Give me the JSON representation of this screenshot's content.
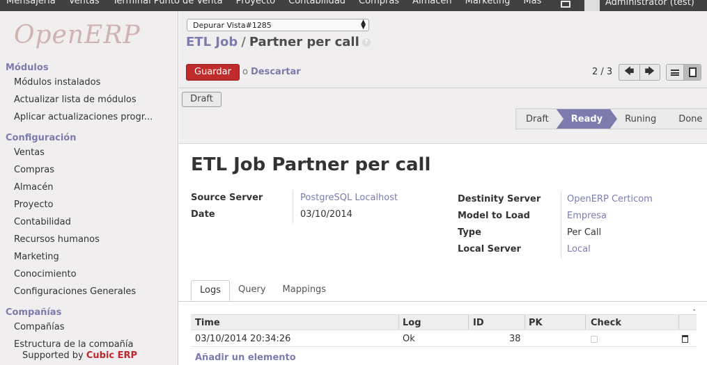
{
  "topbar": {
    "menu": [
      "Mensajería",
      "Ventas",
      "Terminal Punto de Venta",
      "Proyecto",
      "Contabilidad",
      "Compras",
      "Almacén",
      "Marketing",
      "Más"
    ],
    "user": "Administrator (test)"
  },
  "sidebar": {
    "logo": "OpenERP",
    "sections": [
      {
        "title": "Módulos",
        "items": [
          "Módulos instalados",
          "Actualizar lista de módulos",
          "Aplicar actualizaciones progr..."
        ]
      },
      {
        "title": "Configuración",
        "items": [
          "Ventas",
          "Compras",
          "Almacén",
          "Proyecto",
          "Contabilidad",
          "Recursos humanos",
          "Marketing",
          "Conocimiento",
          "Configuraciones Generales"
        ]
      },
      {
        "title": "Compañías",
        "items": [
          "Compañías",
          "Estructura de la compañía"
        ]
      }
    ],
    "supported_prefix": "Supported by",
    "supported_brand": "Cubic ERP"
  },
  "toolbar": {
    "debug_select": "Depurar Vista#1285",
    "breadcrumb_parent": "ETL Job",
    "breadcrumb_sep": "/",
    "breadcrumb_current": "Partner per call",
    "save_label": "Guardar",
    "or_label": "o",
    "discard_label": "Descartar",
    "pager": "2 / 3"
  },
  "statusbar": {
    "draft_button": "Draft",
    "steps": [
      "Draft",
      "Ready",
      "Runing",
      "Done"
    ],
    "active_step": "Ready"
  },
  "form": {
    "title": "ETL Job Partner per call",
    "left_fields": [
      {
        "label": "Source Server",
        "value": "PostgreSQL Localhost",
        "link": true
      },
      {
        "label": "Date",
        "value": "03/10/2014",
        "link": false
      }
    ],
    "right_fields": [
      {
        "label": "Destinity Server",
        "value": "OpenERP Certicom",
        "link": true
      },
      {
        "label": "Model to Load",
        "value": "Empresa",
        "link": true
      },
      {
        "label": "Type",
        "value": "Per Call",
        "link": false
      },
      {
        "label": "Local Server",
        "value": "Local",
        "link": true
      }
    ]
  },
  "tabs": [
    "Logs",
    "Query",
    "Mappings"
  ],
  "logs_table": {
    "columns": [
      "Time",
      "Log",
      "ID",
      "PK",
      "Check"
    ],
    "rows": [
      {
        "time": "03/10/2014 20:34:26",
        "log": "Ok",
        "id": "38",
        "pk": "",
        "check": false
      }
    ],
    "add_label": "Añadir un elemento"
  }
}
